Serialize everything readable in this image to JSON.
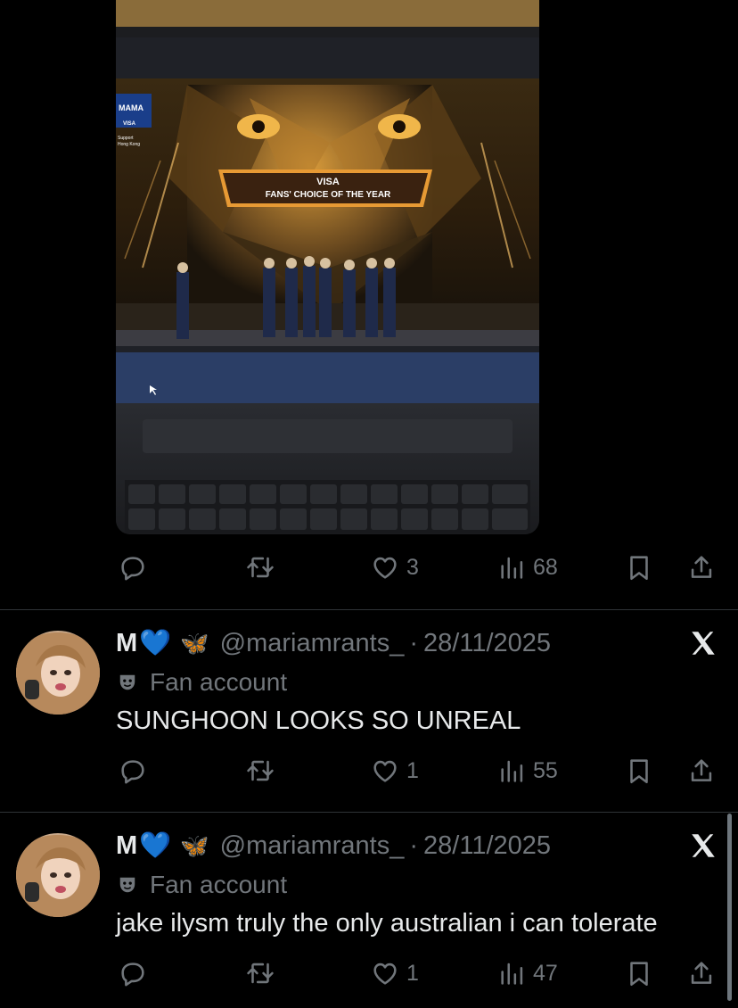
{
  "media": {
    "screen_badge": "MAMA",
    "screen_badge_sub": "VISA",
    "screen_badge_note1": "Support",
    "screen_badge_note2": "Hong Kong",
    "banner_title": "VISA",
    "banner_subtitle": "FANS' CHOICE OF THE YEAR"
  },
  "tweets": [
    {
      "actions": {
        "replies": "",
        "reposts": "",
        "likes": "3",
        "views": "68"
      }
    },
    {
      "name": "M",
      "name_heart": "💙",
      "name_butterfly": "🦋",
      "handle": "@mariamrants_",
      "sep": "·",
      "date": "28/11/2025",
      "badge": "Fan account",
      "text": "SUNGHOON LOOKS SO UNREAL",
      "actions": {
        "replies": "",
        "reposts": "",
        "likes": "1",
        "views": "55"
      }
    },
    {
      "name": "M",
      "name_heart": "💙",
      "name_butterfly": "🦋",
      "handle": "@mariamrants_",
      "sep": "·",
      "date": "28/11/2025",
      "badge": "Fan account",
      "text": "jake ilysm truly the only australian i can tolerate",
      "actions": {
        "replies": "",
        "reposts": "",
        "likes": "1",
        "views": "47"
      }
    }
  ],
  "icons": {
    "reply": "reply-icon",
    "repost": "repost-icon",
    "like": "heart-icon",
    "views": "views-icon",
    "bookmark": "bookmark-icon",
    "share": "share-icon",
    "source": "x-logo-icon",
    "badge": "theater-mask-icon"
  },
  "colors": {
    "background": "#000000",
    "text": "#e7e9ea",
    "muted": "#71767b",
    "divider": "#2f3336",
    "heart_emoji": "#5ec8f2"
  }
}
